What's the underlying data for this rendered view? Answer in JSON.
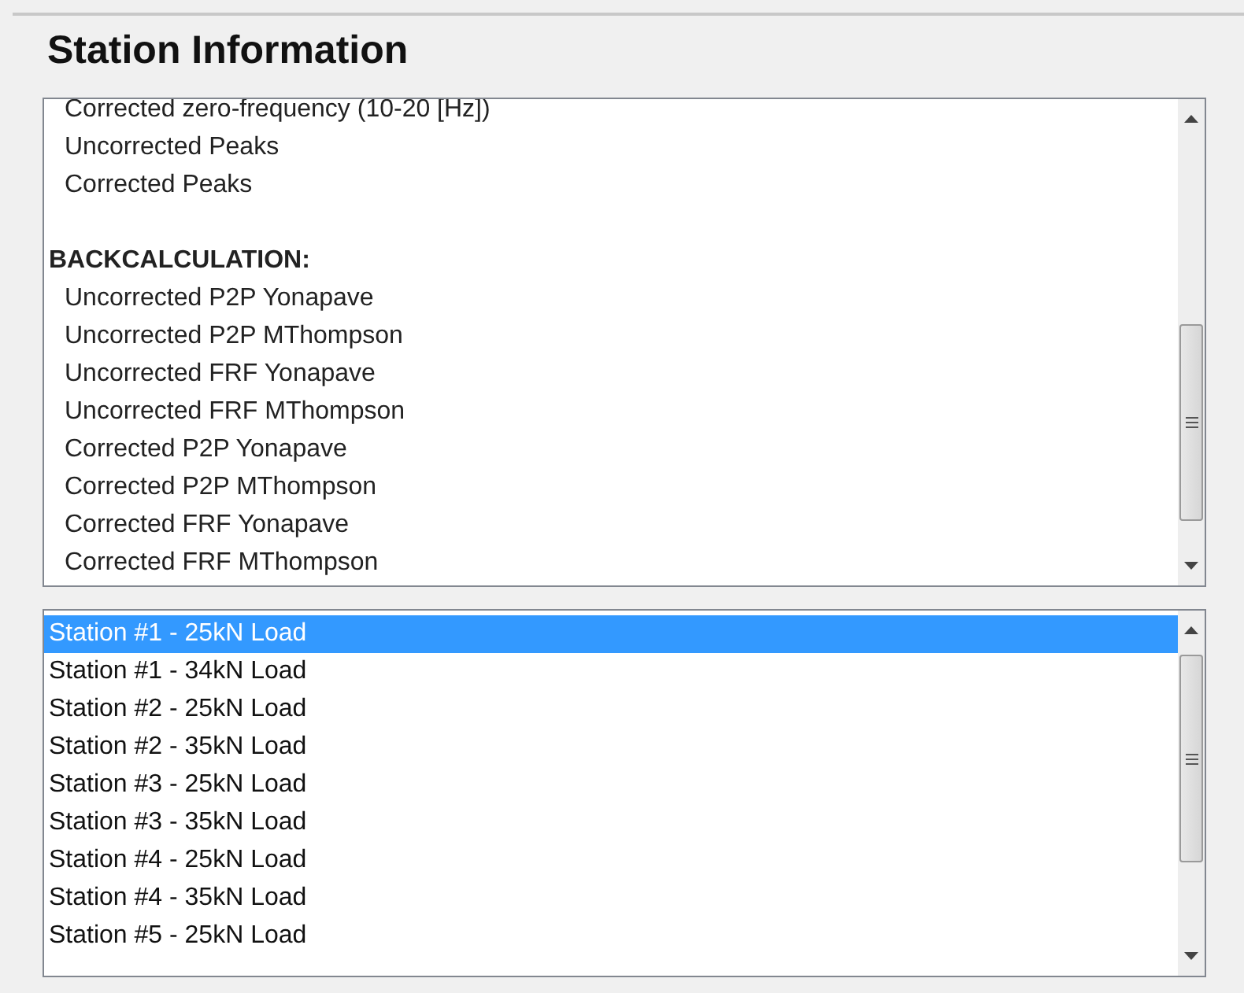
{
  "title": "Station Information",
  "output_list": {
    "items": [
      {
        "kind": "item",
        "label": "Corrected zero-frequency (10-20 [Hz])"
      },
      {
        "kind": "item",
        "label": "Uncorrected Peaks"
      },
      {
        "kind": "item",
        "label": "Corrected Peaks"
      },
      {
        "kind": "header",
        "label": "BACKCALCULATION:"
      },
      {
        "kind": "item",
        "label": "Uncorrected P2P Yonapave"
      },
      {
        "kind": "item",
        "label": "Uncorrected P2P MThompson"
      },
      {
        "kind": "item",
        "label": "Uncorrected FRF Yonapave"
      },
      {
        "kind": "item",
        "label": "Uncorrected FRF MThompson"
      },
      {
        "kind": "item",
        "label": "Corrected P2P Yonapave"
      },
      {
        "kind": "item",
        "label": "Corrected P2P MThompson"
      },
      {
        "kind": "item",
        "label": "Corrected FRF Yonapave"
      },
      {
        "kind": "item",
        "label": "Corrected FRF MThompson"
      }
    ]
  },
  "station_list": {
    "items": [
      {
        "label": "Station #1 - 25kN Load",
        "selected": true
      },
      {
        "label": "Station #1 - 34kN Load",
        "selected": false
      },
      {
        "label": "Station #2 - 25kN Load",
        "selected": false
      },
      {
        "label": "Station #2 - 35kN Load",
        "selected": false
      },
      {
        "label": "Station #3 - 25kN Load",
        "selected": false
      },
      {
        "label": "Station #3 - 35kN Load",
        "selected": false
      },
      {
        "label": "Station #4 - 25kN Load",
        "selected": false
      },
      {
        "label": "Station #4 - 35kN Load",
        "selected": false
      },
      {
        "label": "Station #5 - 25kN Load",
        "selected": false
      }
    ]
  }
}
